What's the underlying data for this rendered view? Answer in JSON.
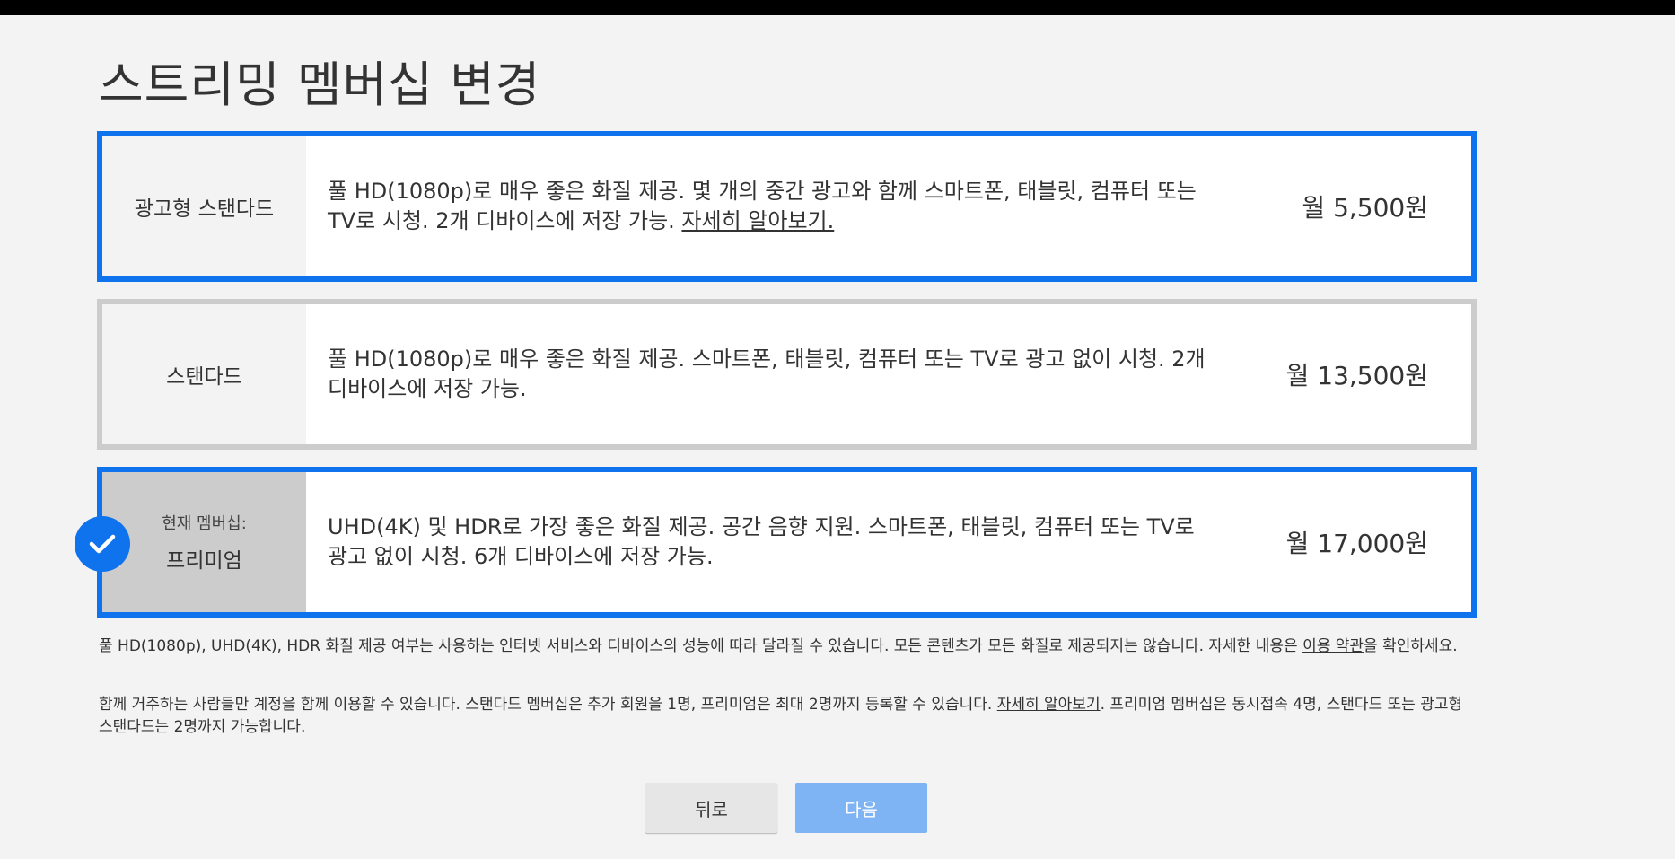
{
  "page": {
    "title": "스트리밍 멤버십 변경",
    "accent_color": "#0f73ee",
    "unselected_border_color": "#cccccc"
  },
  "plans": [
    {
      "name": "광고형 스탠다드",
      "description": "풀 HD(1080p)로 매우 좋은 화질 제공. 몇 개의 중간 광고와 함께 스마트폰, 태블릿, 컴퓨터 또는 TV로 시청. 2개 디바이스에 저장 가능. ",
      "learn_more": "자세히 알아보기.",
      "price": "월 5,500원",
      "state": "selected"
    },
    {
      "name": "스탠다드",
      "description": "풀 HD(1080p)로 매우 좋은 화질 제공. 스마트폰, 태블릿, 컴퓨터 또는 TV로 광고 없이 시청. 2개 디바이스에 저장 가능.",
      "price": "월 13,500원",
      "state": "unselected"
    },
    {
      "current_label": "현재 멤버십:",
      "name": "프리미엄",
      "description": "UHD(4K) 및 HDR로 가장 좋은 화질 제공. 공간 음향 지원. 스마트폰, 태블릿, 컴퓨터 또는 TV로 광고 없이 시청. 6개 디바이스에 저장 가능.",
      "price": "월 17,000원",
      "state": "current",
      "badge_icon": "checkmark-icon"
    }
  ],
  "notes": {
    "quality": {
      "text_before": "풀 HD(1080p), UHD(4K), HDR 화질 제공 여부는 사용하는 인터넷 서비스와 디바이스의 성능에 따라 달라질 수 있습니다. 모든 콘텐츠가 모든 화질로 제공되지는 않습니다. 자세한 내용은 ",
      "link": "이용 약관",
      "text_after": "을 확인하세요."
    },
    "household": {
      "text_before": "함께 거주하는 사람들만 계정을 함께 이용할 수 있습니다. 스탠다드 멤버십은 추가 회원을 1명, 프리미엄은 최대 2명까지 등록할 수 있습니다. ",
      "link": "자세히 알아보기",
      "text_after": ". 프리미엄 멤버십은 동시접속 4명, 스탠다드 또는 광고형 스탠다드는 2명까지 가능합니다."
    }
  },
  "buttons": {
    "back_label": "뒤로",
    "next_label": "다음"
  }
}
